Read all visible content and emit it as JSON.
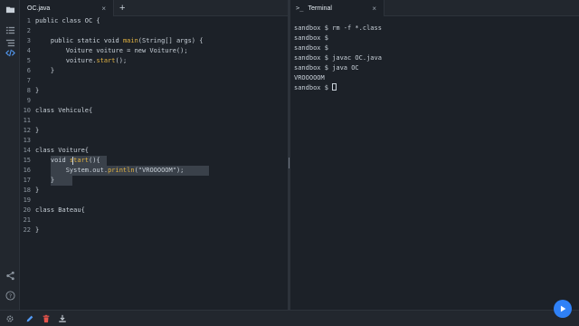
{
  "activity_bar": {
    "icons": [
      "folder-icon",
      "files-icon",
      "outline-icon",
      "code-icon",
      "share-icon",
      "help-icon",
      "settings-icon"
    ]
  },
  "editor": {
    "tab_label": "OC.java",
    "tab_close": "×",
    "add_tab": "+",
    "lines": [
      {
        "n": "1",
        "text": "public class OC {"
      },
      {
        "n": "2",
        "text": ""
      },
      {
        "n": "3",
        "text": "    public static void main(String[] args) {"
      },
      {
        "n": "4",
        "text": "        Voiture voiture = new Voiture();"
      },
      {
        "n": "5",
        "text": "        voiture.start();"
      },
      {
        "n": "6",
        "text": "    }"
      },
      {
        "n": "7",
        "text": ""
      },
      {
        "n": "8",
        "text": "}"
      },
      {
        "n": "9",
        "text": ""
      },
      {
        "n": "10",
        "text": "class Vehicule{"
      },
      {
        "n": "11",
        "text": ""
      },
      {
        "n": "12",
        "text": "}"
      },
      {
        "n": "13",
        "text": ""
      },
      {
        "n": "14",
        "text": "class Voiture{"
      },
      {
        "n": "15",
        "text": "    void start(){"
      },
      {
        "n": "16",
        "text": "        System.out.println(\"VROOOOOM\");"
      },
      {
        "n": "17",
        "text": "    }"
      },
      {
        "n": "18",
        "text": "}"
      },
      {
        "n": "19",
        "text": ""
      },
      {
        "n": "20",
        "text": "class Bateau{"
      },
      {
        "n": "21",
        "text": ""
      },
      {
        "n": "22",
        "text": "}"
      }
    ]
  },
  "terminal": {
    "tab_label": "Terminal",
    "tab_close": "×",
    "prompt_glyph": ">_",
    "lines": [
      "sandbox $ rm -f *.class",
      "sandbox $",
      "sandbox $",
      "sandbox $ javac OC.java",
      "sandbox $ java OC",
      "VROOOOOM",
      "sandbox $ "
    ]
  },
  "bottom_bar": {
    "icons": [
      "edit-icon",
      "delete-icon",
      "download-icon"
    ]
  },
  "run_button": {
    "icon": "play-icon"
  },
  "colors": {
    "background": "#1c2128",
    "accent": "#2f81f7",
    "delete": "#e5534b",
    "edit": "#539bf5",
    "method": "#e3b341"
  }
}
